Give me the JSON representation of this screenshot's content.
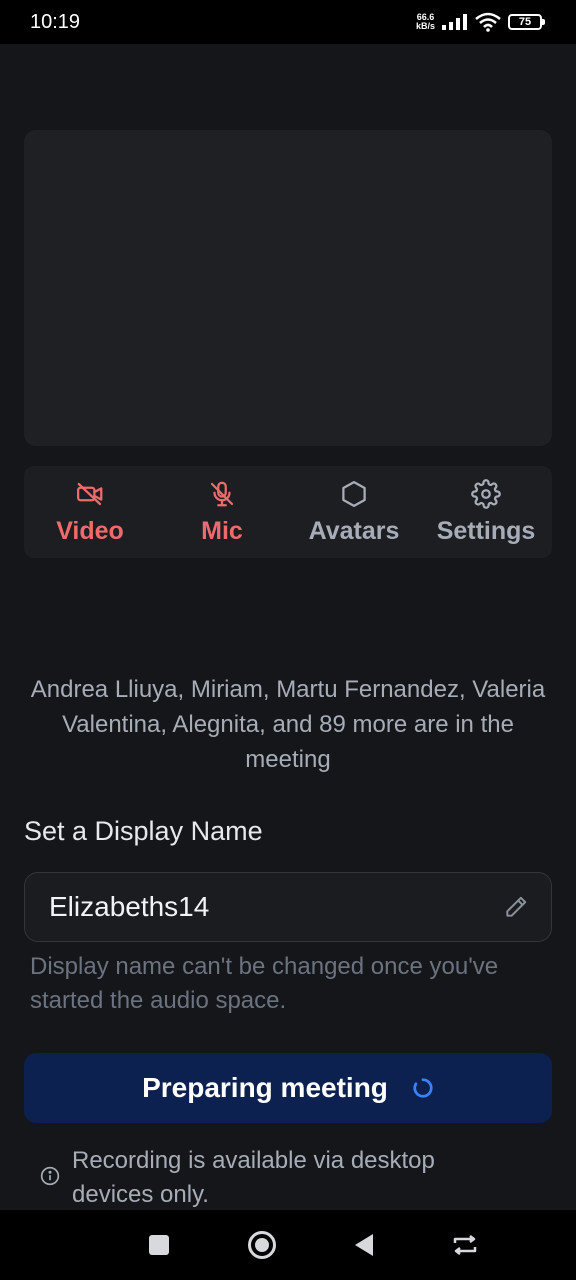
{
  "status_bar": {
    "time": "10:19",
    "net_speed_value": "66.6",
    "net_speed_unit": "kB/s",
    "battery": "75"
  },
  "controls": [
    {
      "label": "Video",
      "icon": "video-off-icon",
      "state": "off"
    },
    {
      "label": "Mic",
      "icon": "mic-off-icon",
      "state": "off"
    },
    {
      "label": "Avatars",
      "icon": "hexagon-icon",
      "state": "neutral"
    },
    {
      "label": "Settings",
      "icon": "gear-icon",
      "state": "neutral"
    }
  ],
  "participants_text": "Andrea Lliuya, Miriam, Martu Fernandez, Valeria Valentina, Alegnita, and 89 more are in the meeting",
  "display_name": {
    "title": "Set a Display Name",
    "value": "Elizabeths14",
    "helper": "Display name can't be changed once you've started the audio space."
  },
  "primary_button": {
    "label": "Preparing meeting"
  },
  "recording_note": "Recording is available via desktop devices only.",
  "colors": {
    "background": "#151619",
    "off_red": "#ef6a6a",
    "neutral_gray": "#a7adb8",
    "button_bg": "#0c2150",
    "spinner_blue": "#3b82f6"
  },
  "nav_bar": {
    "buttons": [
      "recents-square-icon",
      "home-circle-icon",
      "back-triangle-icon",
      "switch-icon"
    ]
  }
}
